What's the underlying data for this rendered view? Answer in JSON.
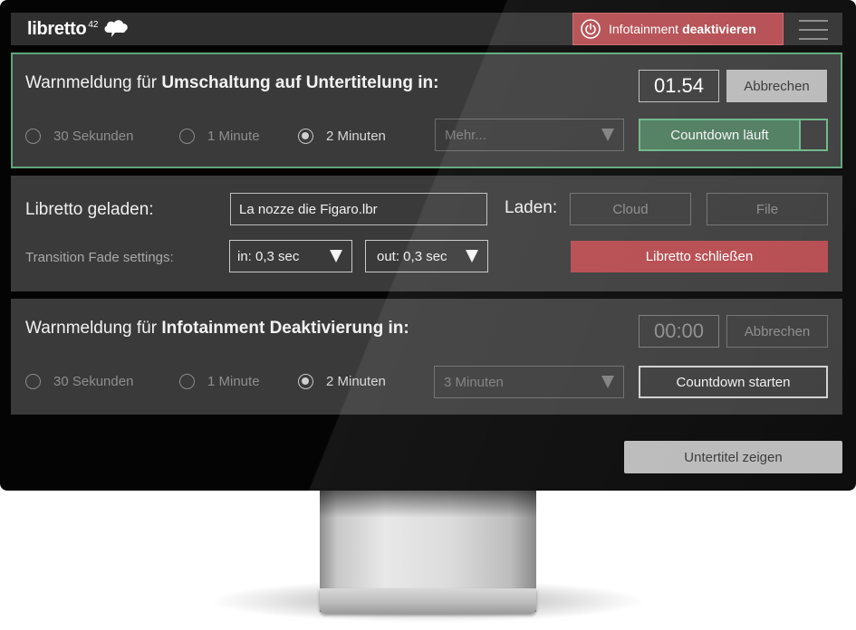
{
  "header": {
    "logo_text": "libretto",
    "logo_sup": "42",
    "deactivate_prefix": "Infotainment",
    "deactivate_bold": "deaktivieren"
  },
  "panel_subtitle_warning": {
    "heading_prefix": "Warnmeldung für",
    "heading_bold": "Umschaltung auf Untertitelung in:",
    "timer": "01.54",
    "cancel_label": "Abbrechen",
    "options": [
      "30 Sekunden",
      "1 Minute",
      "2 Minuten"
    ],
    "selected_option": "2 Minuten",
    "more_placeholder": "Mehr...",
    "countdown_label": "Countdown läuft"
  },
  "panel_libretto": {
    "loaded_label": "Libretto geladen:",
    "file_value": "La nozze die Figaro.lbr",
    "load_label": "Laden:",
    "cloud_label": "Cloud",
    "file_label": "File",
    "fade_label": "Transition Fade settings:",
    "fade_in": "in: 0,3 sec",
    "fade_out": "out: 0,3 sec",
    "close_label": "Libretto schließen"
  },
  "panel_infotainment_warning": {
    "heading_prefix": "Warnmeldung für",
    "heading_bold": "Infotainment Deaktivierung in:",
    "timer": "00:00",
    "cancel_label": "Abbrechen",
    "options": [
      "30 Sekunden",
      "1 Minute",
      "2 Minuten"
    ],
    "selected_option": "2 Minuten",
    "more_value": "3 Minuten",
    "countdown_label": "Countdown starten"
  },
  "footer": {
    "show_subtitles_label": "Untertitel zeigen"
  },
  "colors": {
    "accent_red": "#b44a4f",
    "accent_green": "#4c7a5d",
    "panel_bg": "#3a3a3a",
    "screen_bg": "#040404"
  }
}
